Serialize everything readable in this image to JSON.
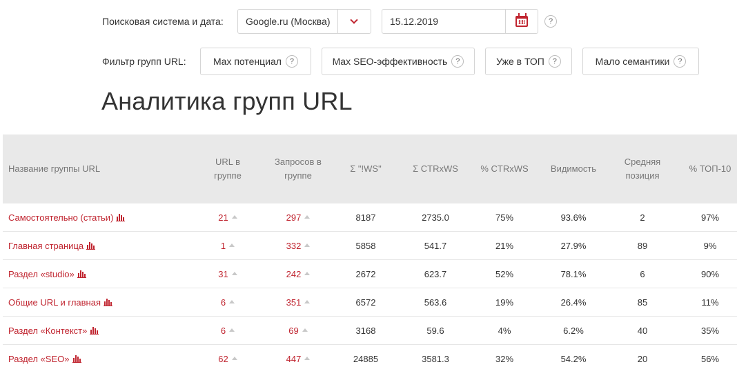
{
  "filters": {
    "search_label": "Поисковая система и дата:",
    "search_engine": "Google.ru (Москва)",
    "date": "15.12.2019",
    "help": "?",
    "group_filter_label": "Фильтр групп URL:",
    "buttons": [
      {
        "label": "Max потенциал",
        "help": "?"
      },
      {
        "label": "Max SEO-эффективность",
        "help": "?"
      },
      {
        "label": "Уже в ТОП",
        "help": "?"
      },
      {
        "label": "Мало семантики",
        "help": "?"
      }
    ]
  },
  "page_title": "Аналитика групп URL",
  "table": {
    "columns": [
      "Название группы URL",
      "URL в группе",
      "Запросов в группе",
      "Σ \"!WS\"",
      "Σ CTRxWS",
      "% CTRxWS",
      "Видимость",
      "Средняя позиция",
      "% ТОП-10"
    ],
    "rows": [
      {
        "name": "Самостоятельно (статьи)",
        "urls": "21",
        "queries": "297",
        "ws": "8187",
        "ctrws": "2735.0",
        "pct_ctr": "75%",
        "visibility": "93.6%",
        "avg_pos": "2",
        "top10": "97%"
      },
      {
        "name": "Главная страница",
        "urls": "1",
        "queries": "332",
        "ws": "5858",
        "ctrws": "541.7",
        "pct_ctr": "21%",
        "visibility": "27.9%",
        "avg_pos": "89",
        "top10": "9%"
      },
      {
        "name": "Раздел «studio»",
        "urls": "31",
        "queries": "242",
        "ws": "2672",
        "ctrws": "623.7",
        "pct_ctr": "52%",
        "visibility": "78.1%",
        "avg_pos": "6",
        "top10": "90%"
      },
      {
        "name": "Общие URL и главная",
        "urls": "6",
        "queries": "351",
        "ws": "6572",
        "ctrws": "563.6",
        "pct_ctr": "19%",
        "visibility": "26.4%",
        "avg_pos": "85",
        "top10": "11%"
      },
      {
        "name": "Раздел «Контекст»",
        "urls": "6",
        "queries": "69",
        "ws": "3168",
        "ctrws": "59.6",
        "pct_ctr": "4%",
        "visibility": "6.2%",
        "avg_pos": "40",
        "top10": "35%"
      },
      {
        "name": "Раздел «SEO»",
        "urls": "62",
        "queries": "447",
        "ws": "24885",
        "ctrws": "3581.3",
        "pct_ctr": "32%",
        "visibility": "54.2%",
        "avg_pos": "20",
        "top10": "56%"
      }
    ]
  },
  "colors": {
    "accent": "#c0242f",
    "header_bg": "#e9e9e9"
  },
  "icons": {
    "dropdown": "chevron-down-icon",
    "calendar": "calendar-icon",
    "help": "help-icon",
    "chart": "bar-chart-icon",
    "sort": "triangle-up-icon"
  }
}
